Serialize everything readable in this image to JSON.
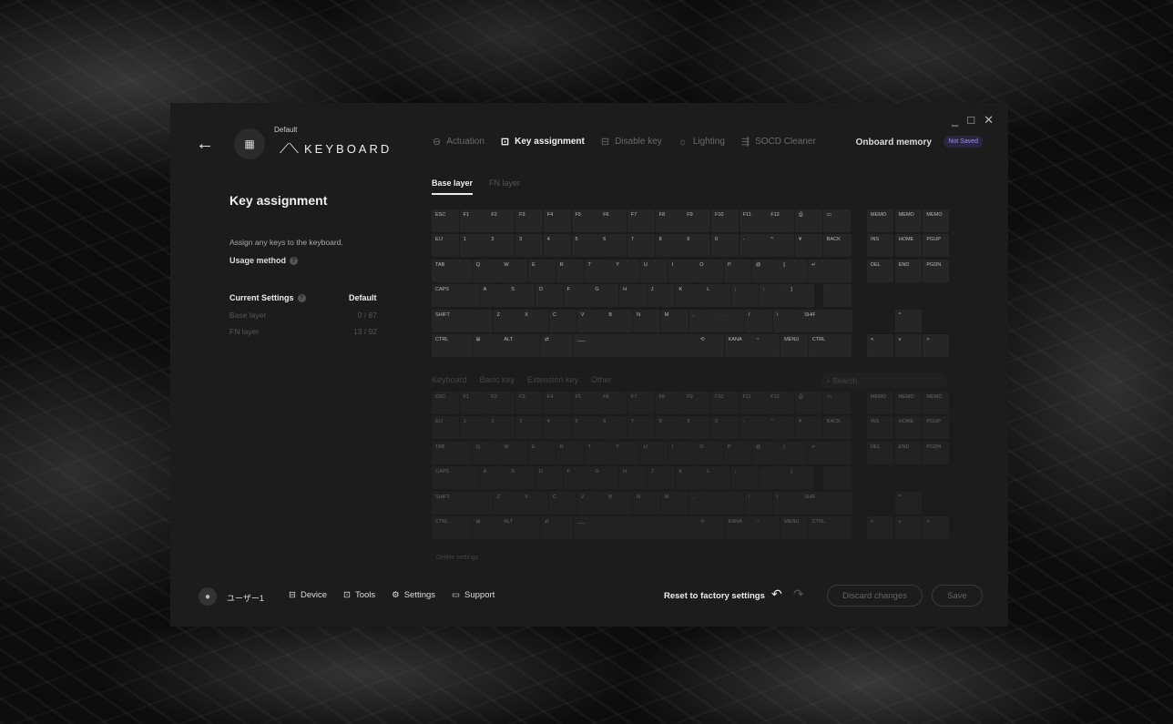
{
  "window": {
    "minimize": "_",
    "maximize": "□",
    "close": "✕"
  },
  "header": {
    "back_icon": "←",
    "app_icon": "▦",
    "profile": "Default",
    "brand_logo": "⟋⟍",
    "brand": "KEYBOARD",
    "onboard_memory": "Onboard memory",
    "save_status": "Not Saved"
  },
  "tabs": [
    {
      "label": "Actuation",
      "icon": "⊖"
    },
    {
      "label": "Key assignment",
      "icon": "⊡"
    },
    {
      "label": "Disable key",
      "icon": "⊟"
    },
    {
      "label": "Lighting",
      "icon": "☼"
    },
    {
      "label": "SOCD Cleaner",
      "icon": "⇶"
    }
  ],
  "left": {
    "title": "Key assignment",
    "description": "Assign any keys to the keyboard.",
    "usage_method": "Usage method",
    "current_settings": "Current Settings",
    "current_value": "Default",
    "rows": [
      {
        "label": "Base layer",
        "value": "0 / 87"
      },
      {
        "label": "FN layer",
        "value": "13 / 92"
      }
    ]
  },
  "layers": [
    "Base layer",
    "FN layer"
  ],
  "categories": [
    "Keyboard",
    "Basic key",
    "Extension key",
    "Other"
  ],
  "search_placeholder": "Search",
  "delete_settings": "Delete settings",
  "keyboard_rows": [
    [
      "ESC",
      "F1",
      "F2",
      "F3",
      "F4",
      "F5",
      "F6",
      "F7",
      "F8",
      "F9",
      "F10",
      "F11",
      "F12",
      "⎙",
      "▭",
      "MEMO",
      "MEMO",
      "MEMO"
    ],
    [
      "E/J",
      "1",
      "2",
      "3",
      "4",
      "5",
      "6",
      "7",
      "8",
      "9",
      "0",
      "-",
      "^",
      "¥",
      "BACK",
      "INS",
      "HOME",
      "PGUP"
    ],
    [
      "TAB",
      "Q",
      "W",
      "E",
      "R",
      "T",
      "Y",
      "U",
      "I",
      "O",
      "P",
      "@",
      "[",
      "↵",
      "DEL",
      "END",
      "PGDN"
    ],
    [
      "CAPS",
      "A",
      "S",
      "D",
      "F",
      "G",
      "H",
      "J",
      "K",
      "L",
      ";",
      ":",
      "]"
    ],
    [
      "SHIFT",
      "Z",
      "X",
      "C",
      "V",
      "B",
      "N",
      "M",
      ",",
      ".",
      "/",
      "\\",
      "SHIFT",
      "^"
    ],
    [
      "CTRL",
      "⊞",
      "ALT",
      "⇄",
      "___",
      "⟲",
      "KANA",
      "~",
      "MENU",
      "CTRL",
      "<",
      "v",
      ">"
    ]
  ],
  "footer": {
    "user": "ユーザー1",
    "nav": [
      {
        "label": "Device",
        "icon": "⊟"
      },
      {
        "label": "Tools",
        "icon": "⊡"
      },
      {
        "label": "Settings",
        "icon": "⚙"
      },
      {
        "label": "Support",
        "icon": "▭"
      }
    ],
    "reset": "Reset to factory settings",
    "undo_icon": "↶",
    "redo_icon": "↷",
    "discard": "Discard changes",
    "save": "Save"
  }
}
